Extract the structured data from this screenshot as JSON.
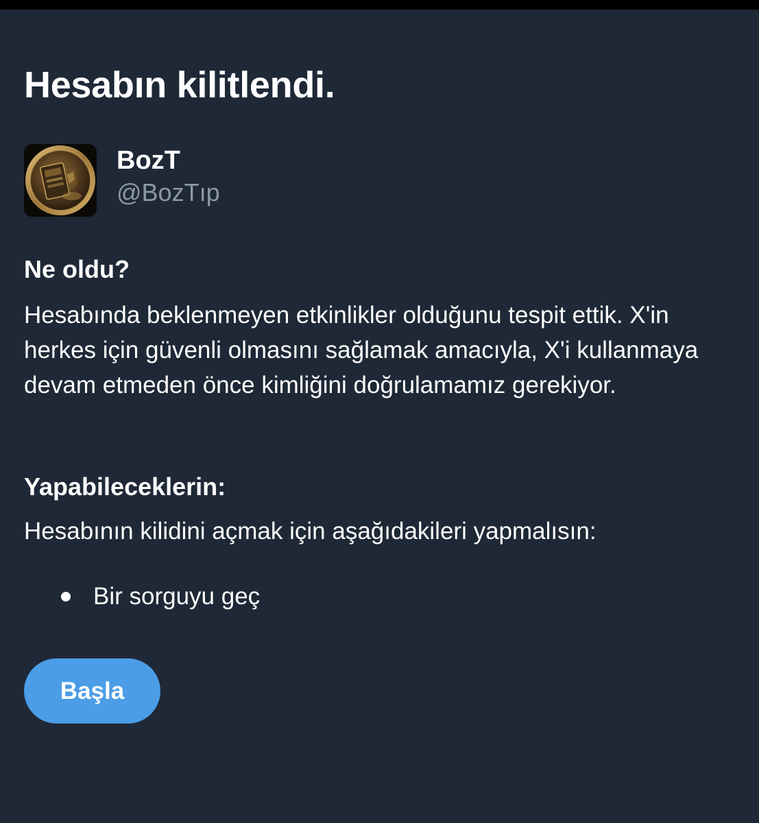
{
  "page": {
    "title": "Hesabın kilitlendi."
  },
  "account": {
    "display_name": "BozT",
    "handle": "@BozTıp",
    "avatar_icon": "gold-coin-avatar"
  },
  "what_happened": {
    "heading": "Ne oldu?",
    "body": "Hesabında beklenmeyen etkinlikler olduğunu tespit ettik. X'in herkes için güvenli olmasını sağlamak amacıyla, X'i kullanmaya devam etmeden önce kimliğini doğrulamamız gerekiyor."
  },
  "what_you_can_do": {
    "heading": "Yapabileceklerin:",
    "body": "Hesabının kilidini açmak için aşağıdakileri yapmalısın:",
    "steps": [
      "Bir sorguyu geç"
    ]
  },
  "actions": {
    "start_label": "Başla"
  },
  "colors": {
    "background": "#1f2836",
    "text": "#ffffff",
    "handle": "#8b98a5",
    "button": "#4a9de6"
  }
}
